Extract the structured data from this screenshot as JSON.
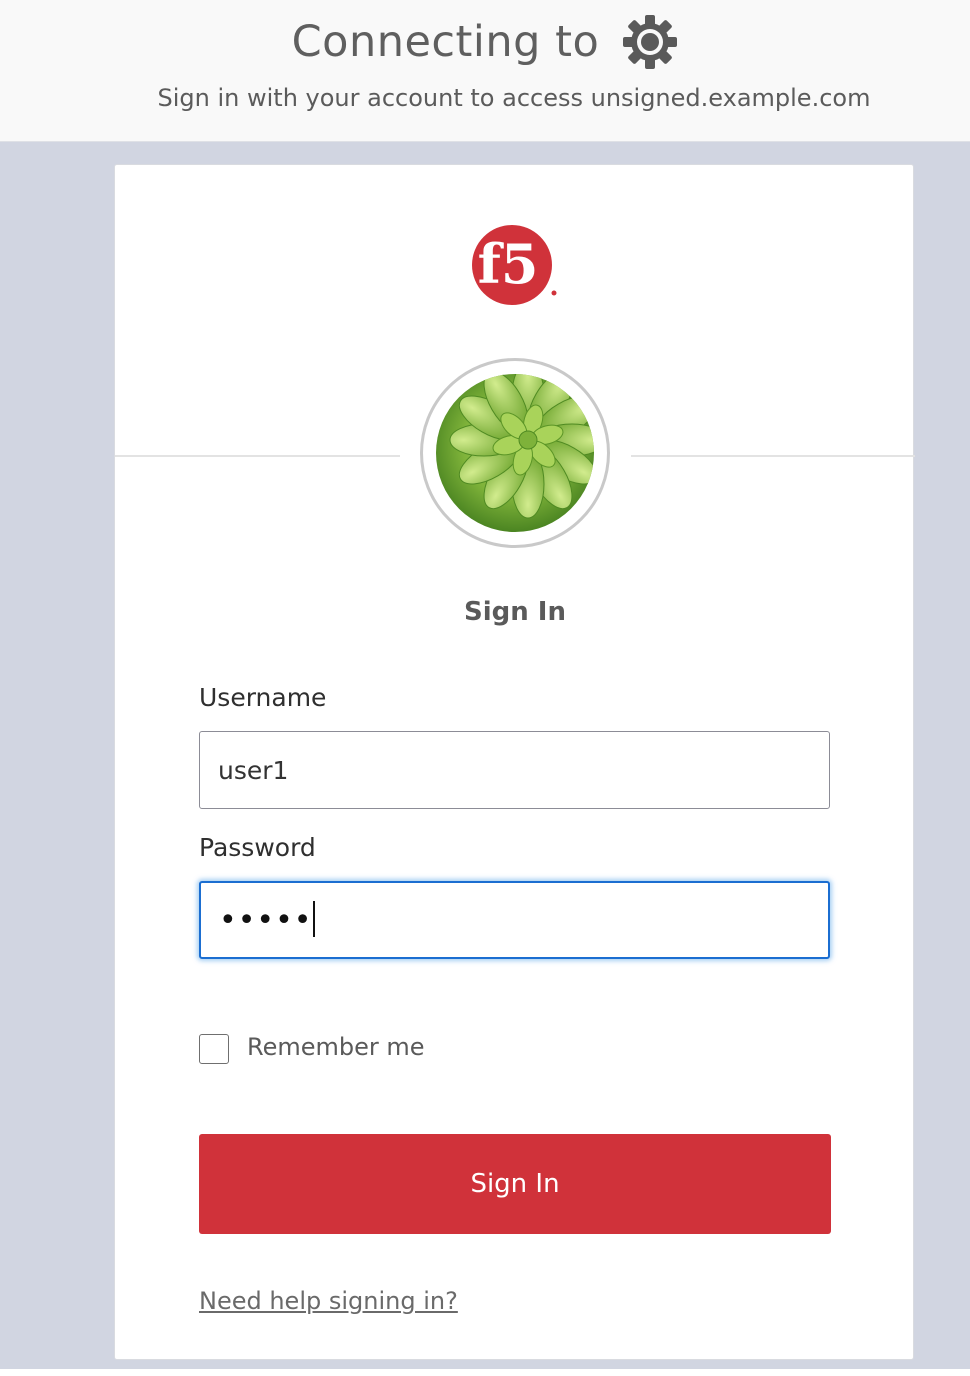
{
  "header": {
    "title": "Connecting to",
    "title_icon": "gear-icon",
    "subtitle": "Sign in with your account to access unsigned.example.com"
  },
  "card": {
    "logo": {
      "icon": "f5-logo",
      "text": "f5",
      "color": "#d0323a"
    },
    "avatar": {
      "icon": "succulent-plant-avatar"
    },
    "heading": "Sign In",
    "username": {
      "label": "Username",
      "value": "user1"
    },
    "password": {
      "label": "Password",
      "masked_value": "•••••"
    },
    "remember": {
      "label": "Remember me",
      "checked": false
    },
    "submit_label": "Sign In",
    "help_link": "Need help signing in?"
  },
  "colors": {
    "accent": "#d0323a",
    "backdrop": "#d1d5e1",
    "focus_border": "#1b6ed1"
  }
}
